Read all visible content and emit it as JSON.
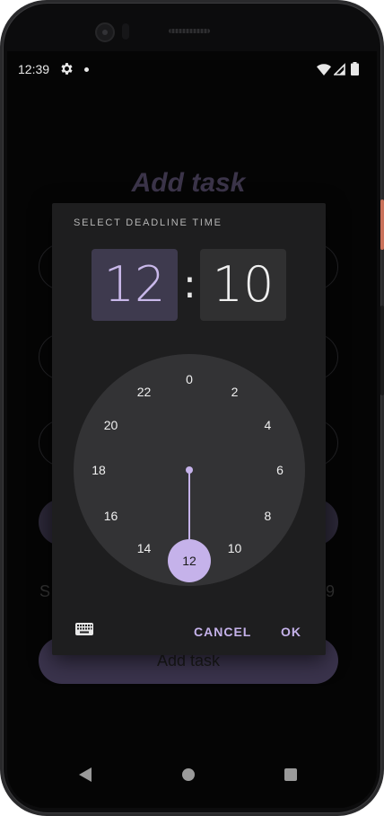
{
  "status_bar": {
    "time": "12:39"
  },
  "background": {
    "title": "Add task",
    "partial_left_text": "S",
    "partial_right_text": "9",
    "add_button_label": "Add task"
  },
  "dialog": {
    "header": "SELECT DEADLINE TIME",
    "hour": "12",
    "separator": ":",
    "minute": "10",
    "clock_numbers": [
      "0",
      "2",
      "4",
      "6",
      "8",
      "10",
      "12",
      "14",
      "16",
      "18",
      "20",
      "22"
    ],
    "selected_value": "12",
    "cancel_label": "CANCEL",
    "ok_label": "OK"
  },
  "colors": {
    "accent": "#c5b2ea",
    "dialog_bg": "#1e1e1f",
    "clock_face": "#333335"
  },
  "icons": {
    "status_settings": "gear-icon",
    "wifi": "wifi-icon",
    "signal": "signal-icon",
    "battery": "battery-icon",
    "keyboard": "keyboard-icon",
    "nav_back": "back-icon",
    "nav_home": "home-icon",
    "nav_recents": "recents-icon"
  }
}
